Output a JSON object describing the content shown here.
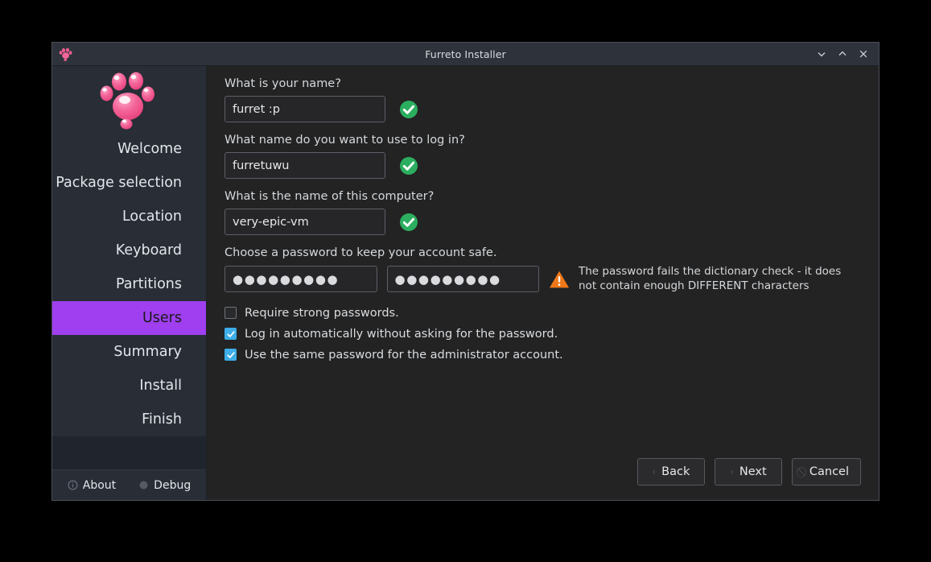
{
  "window": {
    "title": "Furreto Installer",
    "icon": "paw-icon",
    "controls": {
      "minimize": "chevron-down-icon",
      "maximize": "chevron-up-icon",
      "close": "close-icon"
    }
  },
  "sidebar": {
    "logo": "paw-logo",
    "items": [
      {
        "label": "Welcome",
        "active": false
      },
      {
        "label": "Package selection",
        "active": false
      },
      {
        "label": "Location",
        "active": false
      },
      {
        "label": "Keyboard",
        "active": false
      },
      {
        "label": "Partitions",
        "active": false
      },
      {
        "label": "Users",
        "active": true
      },
      {
        "label": "Summary",
        "active": false
      },
      {
        "label": "Install",
        "active": false
      },
      {
        "label": "Finish",
        "active": false
      }
    ],
    "footer": {
      "about_label": "About",
      "about_icon": "info-circle-icon",
      "debug_label": "Debug",
      "debug_icon": "bug-circle-icon"
    }
  },
  "main": {
    "name_field": {
      "label": "What is your name?",
      "value": "furret :p",
      "placeholder": "",
      "status": "valid",
      "status_icon": "check-circle-icon"
    },
    "login_field": {
      "label": "What name do you want to use to log in?",
      "value": "furretuwu",
      "placeholder": "",
      "status": "valid",
      "status_icon": "check-circle-icon"
    },
    "hostname_field": {
      "label": "What is the name of this computer?",
      "value": "very-epic-vm",
      "placeholder": "",
      "status": "valid",
      "status_icon": "check-circle-icon"
    },
    "password_section": {
      "label": "Choose a password to keep your account safe.",
      "password_value": "●●●●●●●●●",
      "password_confirm_value": "●●●●●●●●●",
      "warning_icon": "warning-triangle-icon",
      "warning_text": "The password fails the dictionary check - it does not contain enough DIFFERENT characters"
    },
    "checkboxes": [
      {
        "label": "Require strong passwords.",
        "checked": false
      },
      {
        "label": "Log in automatically without asking for the password.",
        "checked": true
      },
      {
        "label": "Use the same password for the administrator account.",
        "checked": true
      }
    ],
    "buttons": {
      "back": {
        "label": "Back",
        "glyph": "‹"
      },
      "next": {
        "label": "Next",
        "glyph": "›"
      },
      "cancel": {
        "label": "Cancel",
        "glyph": "⃠"
      }
    }
  },
  "colors": {
    "accent_purple": "#9f3fef",
    "sidebar_bg": "#282d36",
    "main_bg": "#232323",
    "titlebar_bg": "#2e333b",
    "valid_green": "#2bae5f",
    "warning_orange": "#f07818",
    "checkbox_blue": "#3daee9",
    "logo_pink": "#f2558c"
  }
}
